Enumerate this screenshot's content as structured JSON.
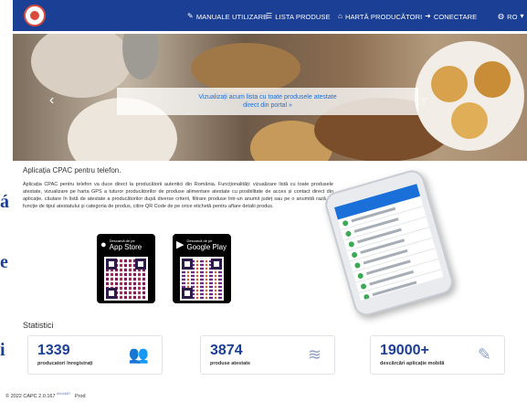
{
  "nav": {
    "items": [
      {
        "label": "MANUALE UTILIZARE",
        "icon": "book-icon"
      },
      {
        "label": "LISTA PRODUSE",
        "icon": "list-icon"
      },
      {
        "label": "HARTĂ PRODUCĂTORI",
        "icon": "map-pin-icon"
      },
      {
        "label": "CONECTARE",
        "icon": "login-icon"
      },
      {
        "label": "RO",
        "icon": "globe-icon"
      }
    ]
  },
  "hero": {
    "caption_line1": "Vizualizați acum lista cu toate produsele atestate",
    "caption_line2": "direct din portal »"
  },
  "app_section": {
    "title": "Aplicația CPAC pentru telefon.",
    "description": "Aplicația CPAC pentru telefon va duce direct la producătorii autentici din România. Funcționalități: vizualizare listă cu toate produsele atestate, vizualizare pe harta GPS a tuturor producătorilor de produse alimentare atestate cu posibilitate de acces și contact direct din aplicație, căutare în listă de atestate a producătorilor după diverse criterii, filtrare produse într-un anumit județ sau pe o anumită rază, în funcție de tipul atestatului și categoria de produs, citire QR Code de pe orice etichetă pentru aflare detalii produs.",
    "app_store": {
      "small": "Descarcă de pe",
      "big": "App Store"
    },
    "google_play": {
      "small": "Descarcă de pe",
      "big": "Google Play"
    }
  },
  "stats": {
    "title": "Statistici",
    "cards": [
      {
        "value": "1339",
        "label": "producatori înregistrați",
        "icon": "users-icon"
      },
      {
        "value": "3874",
        "label": "produse atestate",
        "icon": "food-plate-icon"
      },
      {
        "value": "19000+",
        "label": "descărcări aplicație mobilă",
        "icon": "edit-icon"
      }
    ]
  },
  "footer": {
    "text": "© 2022   CAPC 2.0.167",
    "build": "d6c6687",
    "env": "Prod"
  },
  "edge_letters": [
    "á",
    "e",
    "i"
  ],
  "colors": {
    "navbar": "#1b3f94",
    "accent": "#1b6fd8"
  }
}
